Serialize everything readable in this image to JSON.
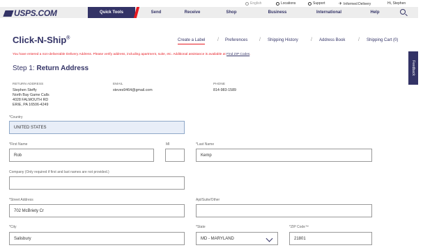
{
  "topbar": {
    "english": "English",
    "locations": "Locations",
    "support": "Support",
    "informed_delivery": "Informed Delivery",
    "greeting": "Hi, Stephen"
  },
  "nav": {
    "logo": "USPS.COM",
    "items": [
      "Quick Tools",
      "Send",
      "Receive",
      "Shop",
      "Business",
      "International",
      "Help"
    ]
  },
  "page": {
    "title": "Click-N-Ship",
    "title_mark": "®",
    "subnav": [
      "Create a Label",
      "Preferences",
      "Shipping History",
      "Address Book",
      "Shipping Cart (0)"
    ],
    "error_text": "You have entered a non-deliverable Delivery Address. Please verify address, including apartment, suite, etc. Additional assistance is available at ",
    "error_link": "Find ZIP Codes",
    "error_end": ".",
    "feedback": "Feedback",
    "step_prefix": "Step 1: ",
    "step_title": "Return Address"
  },
  "return_address": {
    "address_label": "RETURN ADDRESS",
    "lines": [
      "Stephen Steffy",
      "North Bay Game Calls",
      "4028 FALMOUTH RD",
      "ERIE, PA 16506-4249"
    ],
    "email_label": "EMAIL",
    "email": "steves9464@gmail.com",
    "phone_label": "PHONE",
    "phone": "814-983-1589"
  },
  "form": {
    "country_label": "*Country",
    "country": "UNITED STATES",
    "first_name_label": "*First Name",
    "first_name": "Rob",
    "mi_label": "MI",
    "mi": "",
    "last_name_label": "*Last Name",
    "last_name": "Kemp",
    "company_label": "Company (Only required if first and last names are not provided.)",
    "company": "",
    "street_label": "*Street Address",
    "street": "702 McBriety Cr",
    "apt_label": "Apt/Suite/Other",
    "apt": "",
    "city_label": "*City",
    "city": "Salisbury",
    "state_label": "*State",
    "state": "MD - MARYLAND",
    "zip_label": "*ZIP Code™",
    "zip": "21801"
  },
  "colors": {
    "navy": "#333366",
    "red": "#e71921"
  }
}
